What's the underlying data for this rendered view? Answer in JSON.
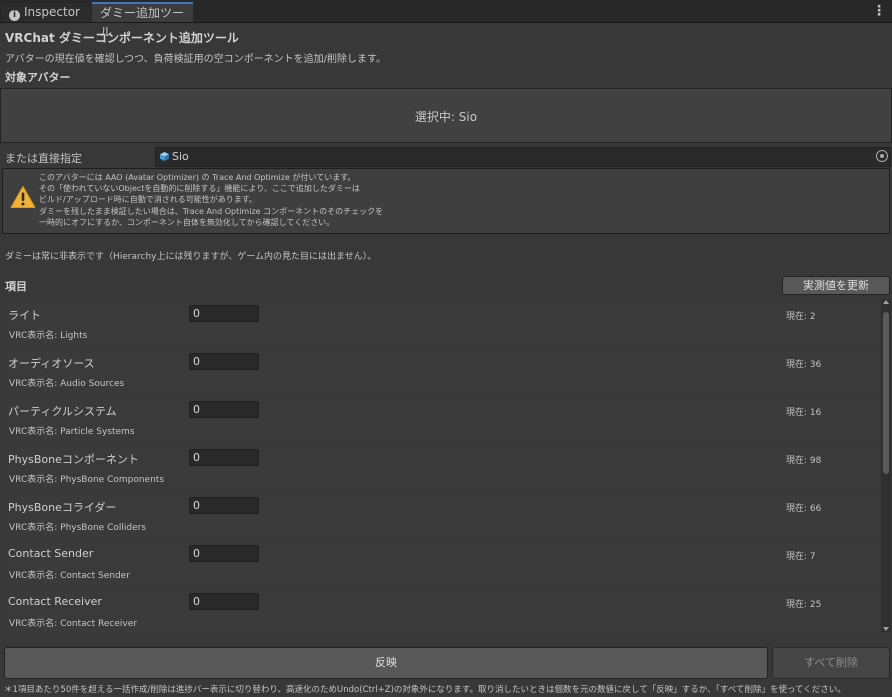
{
  "tabs": [
    {
      "label": "Inspector",
      "icon": "info-icon"
    },
    {
      "label": "ダミー追加ツール"
    }
  ],
  "tab_menu_glyph": "⋮",
  "title": "VRChat ダミーコンポーネント追加ツール",
  "description": "アバターの現在値を確認しつつ、負荷検証用の空コンポーネントを追加/削除します。",
  "target": {
    "header": "対象アバター",
    "selected_label": "選択中: Sio",
    "direct_label": "または直接指定",
    "object_value": "Sio"
  },
  "warning": {
    "icon": "warning-icon",
    "lines": [
      "このアバターには AAO (Avatar Optimizer) の Trace And Optimize が付いています。",
      "その「使われていないObjectを自動的に削除する」機能により、ここで追加したダミーは",
      "ビルド/アップロード時に自動で消される可能性があります。",
      "ダミーを残したまま検証したい場合は、Trace And Optimize コンポーネントのそのチェックを",
      "一時的にオフにするか、コンポーネント自体を無効化してから確認してください。"
    ]
  },
  "hidden_note": "ダミーは常に非表示です（Hierarchy上には残りますが、ゲーム内の見た目には出ません）。",
  "items": {
    "header": "項目",
    "refresh_label": "実測値を更新",
    "rows": [
      {
        "name": "ライト",
        "sub": "VRC表示名: Lights",
        "value": "0",
        "current": "現在: 2"
      },
      {
        "name": "オーディオソース",
        "sub": "VRC表示名: Audio Sources",
        "value": "0",
        "current": "現在: 36"
      },
      {
        "name": "パーティクルシステム",
        "sub": "VRC表示名: Particle Systems",
        "value": "0",
        "current": "現在: 16"
      },
      {
        "name": "PhysBoneコンポーネント",
        "sub": "VRC表示名: PhysBone Components",
        "value": "0",
        "current": "現在: 98"
      },
      {
        "name": "PhysBoneコライダー",
        "sub": "VRC表示名: PhysBone Colliders",
        "value": "0",
        "current": "現在: 66"
      },
      {
        "name": "Contact Sender",
        "sub": "VRC表示名: Contact Sender",
        "value": "0",
        "current": "現在: 7"
      },
      {
        "name": "Contact Receiver",
        "sub": "VRC表示名: Contact Receiver",
        "value": "0",
        "current": "現在: 25"
      }
    ]
  },
  "actions": {
    "apply_label": "反映",
    "delete_all_label": "すべて削除"
  },
  "footer_note": "＊1項目あたり50件を超える一括作成/削除は進捗バー表示に切り替わり、高速化のためUndo(Ctrl+Z)の対象外になります。取り消したいときは個数を元の数値に戻して「反映」するか、「すべて削除」を使ってください。",
  "colors": {
    "background": "#383838",
    "accent_tab": "#3a79bb",
    "warning_yellow": "#f2b233"
  }
}
